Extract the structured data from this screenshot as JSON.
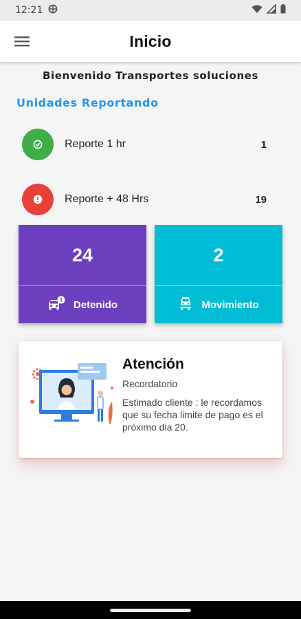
{
  "status_bar": {
    "time": "12:21",
    "icons": [
      "vpn-icon",
      "wifi-icon",
      "signal-icon",
      "battery-icon"
    ]
  },
  "app_bar": {
    "title": "Inicio",
    "menu_icon": "menu-icon"
  },
  "welcome": "Bienvenido Transportes soluciones",
  "section_title": "Unidades Reportando",
  "reports": [
    {
      "label": "Reporte 1 hr",
      "count": "1",
      "icon": "check-circle-icon",
      "color": "#3fae49"
    },
    {
      "label": "Reporte + 48 Hrs",
      "count": "19",
      "icon": "alert-circle-icon",
      "color": "#e8413a"
    }
  ],
  "tiles": [
    {
      "value": "24",
      "label": "Detenido",
      "icon": "car-alert-icon",
      "color": "#6c3fbe"
    },
    {
      "value": "2",
      "label": "Movimiento",
      "icon": "train-car-icon",
      "color": "#00bcd4"
    }
  ],
  "notice": {
    "title": "Atención",
    "subtitle": "Recordatorio",
    "body": "Estimado cliente : le recordamos que su fecha limite de pago es el próximo dia 20.",
    "illustration": "support-agent-illustration"
  },
  "colors": {
    "accent": "#2196f3",
    "purple": "#6c3fbe",
    "cyan": "#00bcd4",
    "green": "#3fae49",
    "red": "#e8413a"
  }
}
